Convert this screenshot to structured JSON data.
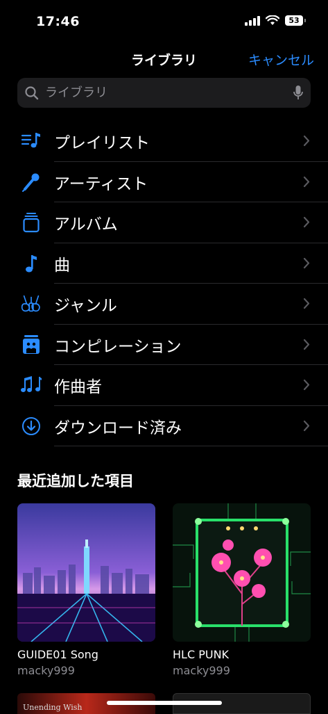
{
  "status": {
    "time": "17:46",
    "battery": "53"
  },
  "nav": {
    "title": "ライブラリ",
    "cancel": "キャンセル"
  },
  "search": {
    "placeholder": "ライブラリ"
  },
  "menu": [
    {
      "label": "プレイリスト",
      "icon": "playlist-icon"
    },
    {
      "label": "アーティスト",
      "icon": "microphone-icon"
    },
    {
      "label": "アルバム",
      "icon": "album-stack-icon"
    },
    {
      "label": "曲",
      "icon": "music-note-icon"
    },
    {
      "label": "ジャンル",
      "icon": "guitars-icon"
    },
    {
      "label": "コンピレーション",
      "icon": "compilation-icon"
    },
    {
      "label": "作曲者",
      "icon": "composer-notes-icon"
    },
    {
      "label": "ダウンロード済み",
      "icon": "download-circle-icon"
    }
  ],
  "recent": {
    "title": "最近追加した項目",
    "albums": [
      {
        "title": "GUIDE01 Song",
        "artist": "macky999"
      },
      {
        "title": "HLC PUNK",
        "artist": "macky999"
      },
      {
        "title": "Unending Wish"
      }
    ]
  },
  "colors": {
    "accent": "#2b8cff",
    "background": "#000000",
    "secondary_text": "#8d8d93"
  }
}
